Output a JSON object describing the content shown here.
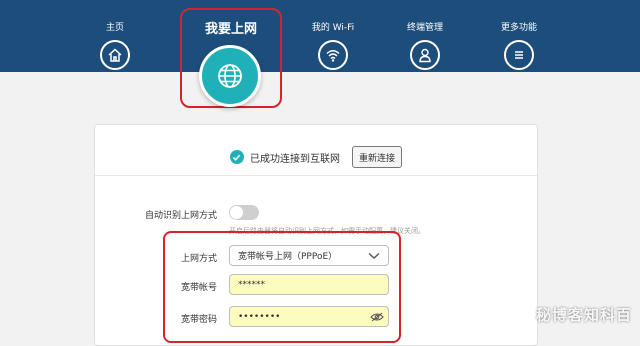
{
  "nav": {
    "home": {
      "label": "主页",
      "icon": "home-icon"
    },
    "internet": {
      "label": "我要上网",
      "icon": "globe-icon"
    },
    "wifi": {
      "label": "我的 Wi-Fi",
      "icon": "wifi-icon"
    },
    "devices": {
      "label": "终端管理",
      "icon": "user-icon"
    },
    "more": {
      "label": "更多功能",
      "icon": "menu-icon"
    }
  },
  "status": {
    "text": "已成功连接到互联网",
    "reconnect_label": "重新连接"
  },
  "auto_detect": {
    "label": "自动识别上网方式",
    "enabled": false,
    "hint": "开启后路由器将自动识别上网方式，如需手动配置，建议关闭。"
  },
  "form": {
    "mode_label": "上网方式",
    "mode_value": "宽带帐号上网（PPPoE）",
    "account_label": "宽带帐号",
    "account_value": "******",
    "password_label": "宽带密码",
    "password_value": "••••••••"
  },
  "watermark": "秘博客知科百",
  "colors": {
    "topbar": "#1d4d7a",
    "accent": "#1fb0b8",
    "highlight_border": "#d6232b",
    "input_fill": "#fdfcbf"
  }
}
